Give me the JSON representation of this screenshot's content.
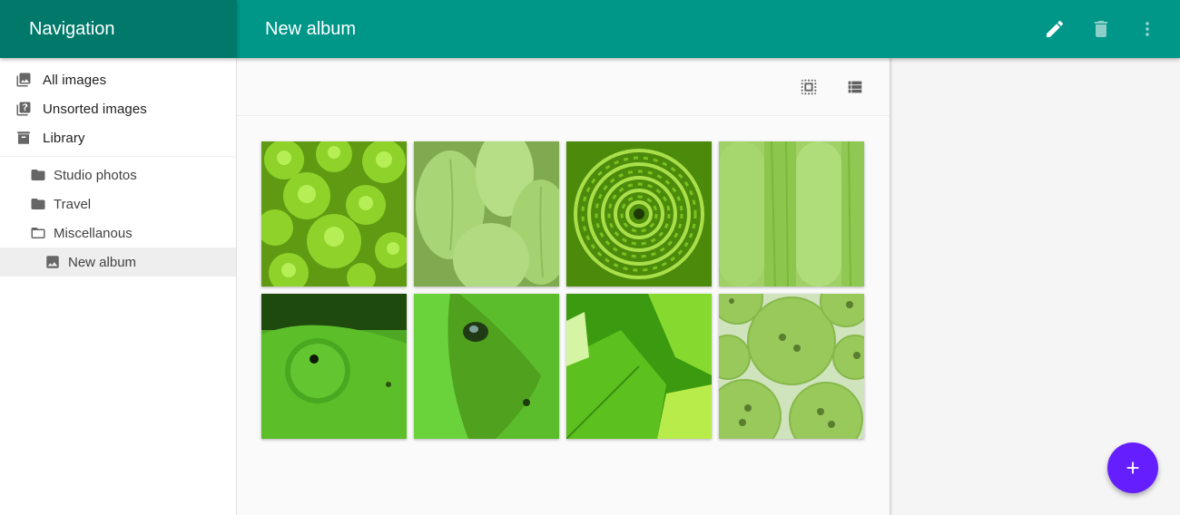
{
  "navigation": {
    "title": "Navigation",
    "items": [
      {
        "label": "All images",
        "icon": "photo-library-icon"
      },
      {
        "label": "Unsorted images",
        "icon": "unsorted-images-icon"
      },
      {
        "label": "Library",
        "icon": "archive-icon"
      }
    ],
    "folders": [
      {
        "label": "Studio photos",
        "icon": "folder-icon"
      },
      {
        "label": "Travel",
        "icon": "folder-icon"
      },
      {
        "label": "Miscellanous",
        "icon": "folder-open-outline-icon"
      }
    ],
    "albums": [
      {
        "label": "New album",
        "icon": "image-icon",
        "selected": true
      }
    ]
  },
  "app_bar": {
    "title": "New album",
    "actions": [
      {
        "name": "edit",
        "icon": "pencil-icon"
      },
      {
        "name": "delete",
        "icon": "trash-icon"
      },
      {
        "name": "more",
        "icon": "more-vert-icon"
      }
    ]
  },
  "toolbar": {
    "tools": [
      {
        "name": "select-all",
        "icon": "select-all-icon"
      },
      {
        "name": "list-view",
        "icon": "list-view-icon"
      }
    ]
  },
  "images": [
    {
      "subject": "romanesco broccoli"
    },
    {
      "subject": "green tulip buds"
    },
    {
      "subject": "green chrysanthemum"
    },
    {
      "subject": "green macarons"
    },
    {
      "subject": "chameleon eye"
    },
    {
      "subject": "green snake"
    },
    {
      "subject": "green leaves"
    },
    {
      "subject": "green buttons"
    }
  ],
  "colors": {
    "primary": "#009688",
    "primary_dark": "#00796b",
    "accent": "#651fff"
  },
  "fab": {
    "icon": "plus-icon",
    "action": "add"
  }
}
